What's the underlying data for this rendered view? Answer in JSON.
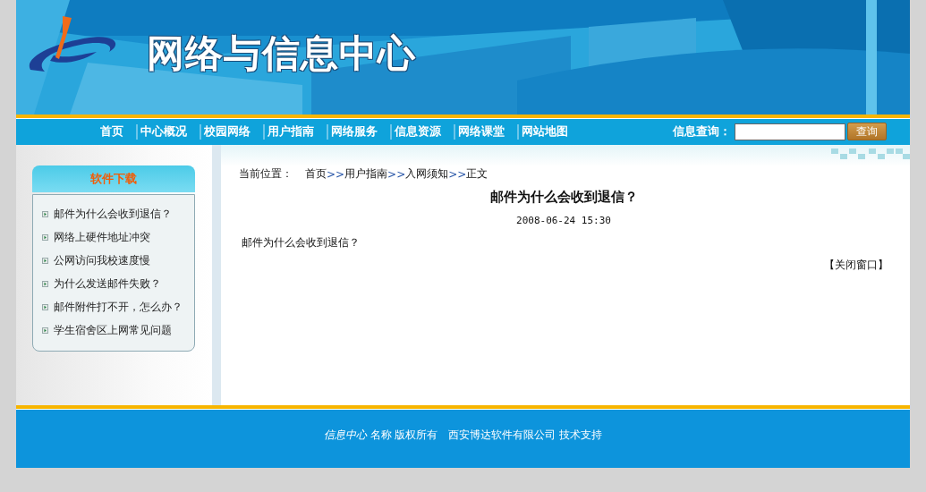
{
  "header": {
    "title": "网络与信息中心"
  },
  "nav": {
    "items": [
      {
        "label": "首页"
      },
      {
        "label": "中心概况"
      },
      {
        "label": "校园网络"
      },
      {
        "label": "用户指南"
      },
      {
        "label": "网络服务"
      },
      {
        "label": "信息资源"
      },
      {
        "label": "网络课堂"
      },
      {
        "label": "网站地图"
      }
    ],
    "search": {
      "label": "信息查询：",
      "button": "查询"
    }
  },
  "sidebar": {
    "title": "软件下载",
    "items": [
      {
        "label": "邮件为什么会收到退信？"
      },
      {
        "label": "网络上硬件地址冲突"
      },
      {
        "label": "公网访问我校速度慢"
      },
      {
        "label": "为什么发送邮件失败？"
      },
      {
        "label": "邮件附件打不开，怎么办？"
      },
      {
        "label": "学生宿舍区上网常见问题"
      }
    ]
  },
  "article": {
    "breadcrumb": {
      "label": "当前位置：",
      "separator": ">>",
      "items": [
        "首页",
        "用户指南",
        "入网须知",
        "正文"
      ]
    },
    "title": "邮件为什么会收到退信？",
    "date": "2008-06-24 15:30",
    "body": "邮件为什么会收到退信？",
    "close": "【关闭窗口】"
  },
  "footer": {
    "text": "*信息中心* 名称 版权所有　西安博达软件有限公司 技术支持"
  }
}
